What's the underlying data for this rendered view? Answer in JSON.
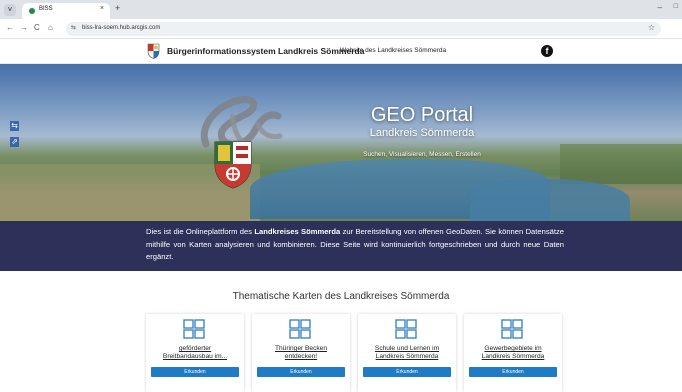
{
  "browser": {
    "tab_title": "BISS",
    "tab_close": "×",
    "new_tab": "+",
    "tab_list": "˅",
    "minimize": "–",
    "maximize": "□",
    "url": "biss-lra-soem.hub.arcgis.com",
    "nav": {
      "back": "←",
      "forward": "→",
      "reload": "C",
      "home": "⌂"
    },
    "site_info": "⇆",
    "bookmark": "☆"
  },
  "header": {
    "title": "Bürgerinformationssystem Landkreis Sömmerda",
    "external_link": "Website des Landkreises Sömmerda",
    "facebook_glyph": "f"
  },
  "hero": {
    "title": "GEO Portal",
    "subtitle": "Landkreis Sömmerda",
    "tagline": "Suchen, Visualisieren, Messen, Erstellen",
    "side_buttons": [
      "⇆",
      "⇗"
    ]
  },
  "intro": {
    "part1": "Dies ist die Onlineplattform des ",
    "bold": "Landkreises Sömmerda",
    "part2": " zur Bereitstellung von offenen GeoDaten. Sie können Datensätze mithilfe von Karten analysieren und kombinieren. Diese Seite wird kontinuierlich fortgeschrieben und durch neue Daten ergänzt."
  },
  "maps": {
    "heading": "Thematische Karten des Landkreises Sömmerda",
    "cards": [
      {
        "line1": "geförderter",
        "line2": "Breitbandausbau im...",
        "button": "Erkunden"
      },
      {
        "line1": "Thüringer Becken",
        "line2": "entdecken!",
        "button": "Erkunden"
      },
      {
        "line1": "Schule und Lernen im",
        "line2": "Landkreis Sömmerda",
        "button": "Erkunden"
      },
      {
        "line1": "Gewerbegebiete im",
        "line2": "Landkreis Sömmerda",
        "button": "Erkunden"
      }
    ]
  },
  "colors": {
    "intro_band": "#2d3059",
    "button": "#1f7bc5",
    "card_icon": "#2f7fc1"
  }
}
